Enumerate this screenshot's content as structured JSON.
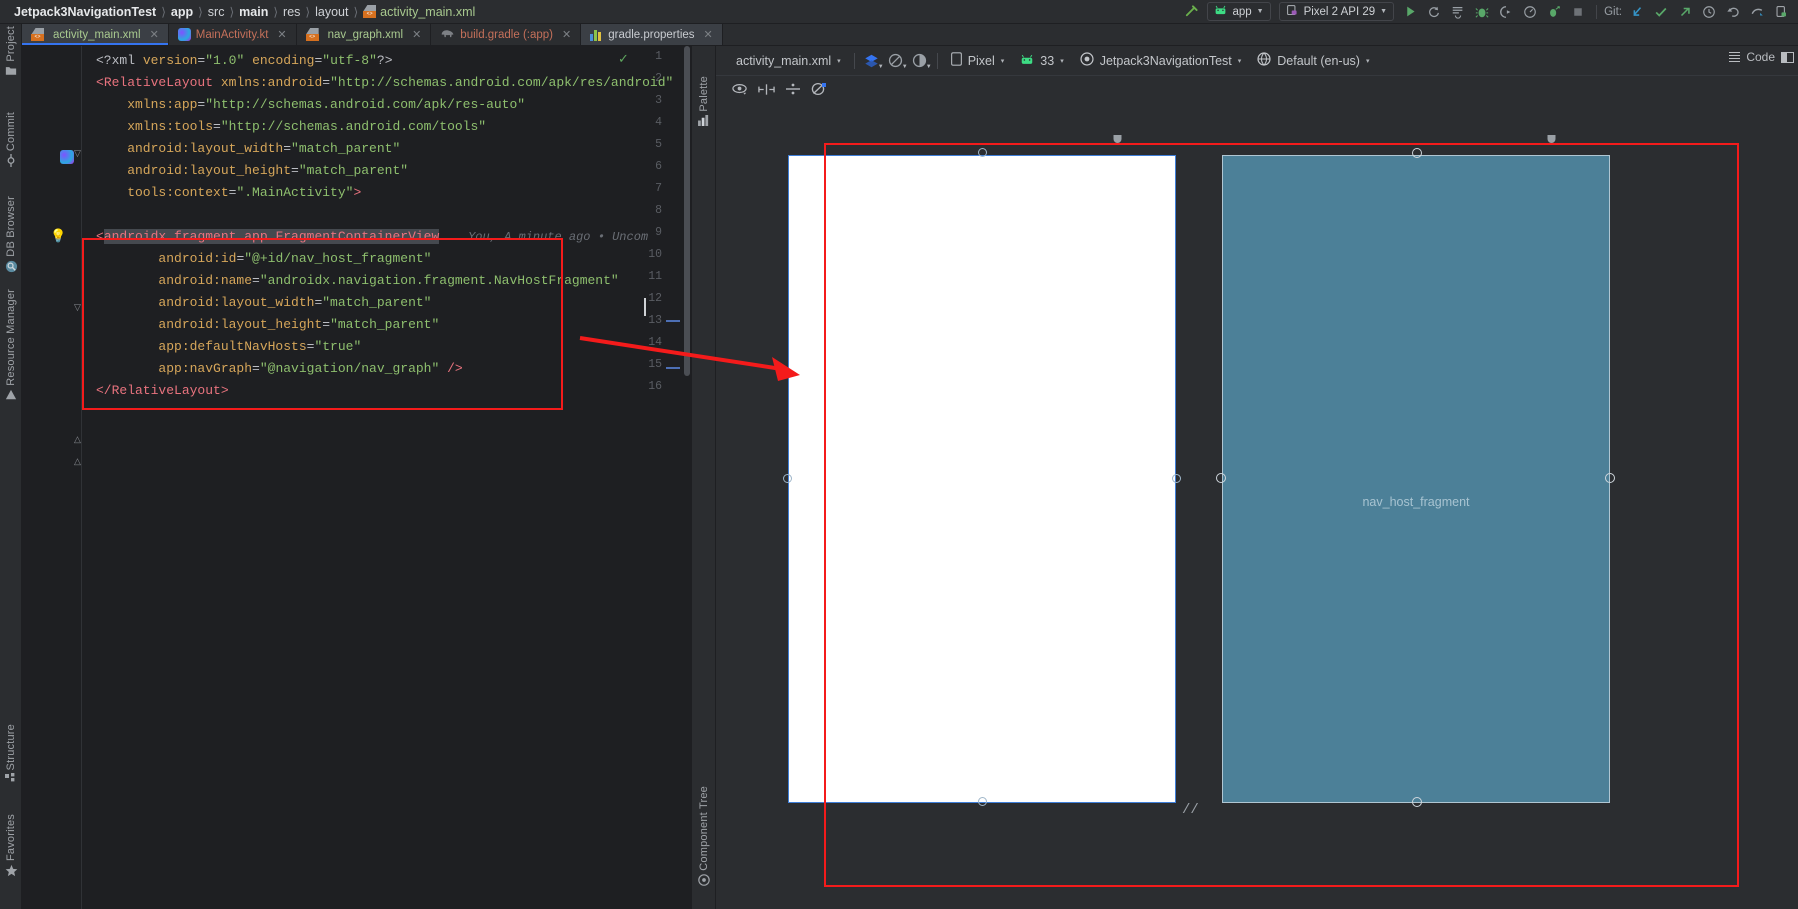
{
  "window": {
    "breadcrumb": [
      "Jetpack3NavigationTest",
      "app",
      "src",
      "main",
      "res",
      "layout",
      "activity_main.xml"
    ],
    "breadcrumb_file": "activity_main.xml"
  },
  "toolbar": {
    "run_config": "app",
    "device": "Pixel 2 API 29",
    "git_label": "Git:",
    "icons": [
      "hammer-icon",
      "run-icon",
      "rerun-icon",
      "run-with-coverage-icon",
      "debug-icon",
      "attach-debugger-icon",
      "profiler-icon",
      "profile-app-icon",
      "stop-icon",
      "git-update-icon",
      "git-commit-icon",
      "git-push-icon",
      "history-icon",
      "undo-icon",
      "search-everywhere-icon",
      "device-manager-icon"
    ]
  },
  "tabs": [
    {
      "label": "activity_main.xml",
      "icon": "xml-layout-icon",
      "active": true
    },
    {
      "label": "MainActivity.kt",
      "icon": "kotlin-icon",
      "active": false
    },
    {
      "label": "nav_graph.xml",
      "icon": "xml-layout-icon",
      "active": false
    },
    {
      "label": "build.gradle (:app)",
      "icon": "gradle-elephant-icon",
      "active": false
    },
    {
      "label": "gradle.properties",
      "icon": "gradle-properties-icon",
      "active": false
    }
  ],
  "view_switch": {
    "code_label": "Code",
    "split_icon": "split-view-icon",
    "code_icon": "code-view-icon"
  },
  "left_stripe": {
    "top": [
      {
        "label": "Project",
        "icon": "folder-icon"
      },
      {
        "label": "Commit",
        "icon": "commit-icon"
      },
      {
        "label": "DB Browser",
        "icon": "database-icon"
      },
      {
        "label": "Resource Manager",
        "icon": "resource-icon"
      }
    ],
    "bottom": [
      {
        "label": "Structure",
        "icon": "structure-icon"
      },
      {
        "label": "Favorites",
        "icon": "star-icon"
      }
    ]
  },
  "design_stripe": {
    "top_label": "Palette",
    "top_icon": "palette-icon",
    "bottom_label": "Component Tree",
    "bottom_icon": "component-tree-icon"
  },
  "design_toolbar": {
    "file": "activity_main.xml",
    "design_mode_icon": "layers-icon",
    "orientation_icon": "orientation-icon",
    "theme_icon": "night-mode-icon",
    "device": "Pixel",
    "api": "33",
    "theme": "Jetpack3NavigationTest",
    "locale": "Default (en-us)",
    "row2_icons": [
      "show-constraints-icon",
      "align-horizontal-icon",
      "align-vertical-icon",
      "clear-constraints-icon"
    ]
  },
  "canvas": {
    "device_label": "nav_host_fragment",
    "white_preview_name": "design-preview",
    "blueprint_preview_name": "blueprint-preview"
  },
  "code": {
    "lines": [
      {
        "n": 1,
        "segments": [
          {
            "t": "<?xml ",
            "c": "proc"
          },
          {
            "t": "version",
            "c": "attr"
          },
          {
            "t": "=",
            "c": "plain"
          },
          {
            "t": "\"1.0\"",
            "c": "str"
          },
          {
            "t": " ",
            "c": "plain"
          },
          {
            "t": "encoding",
            "c": "attr"
          },
          {
            "t": "=",
            "c": "plain"
          },
          {
            "t": "\"utf-8\"",
            "c": "str"
          },
          {
            "t": "?>",
            "c": "proc"
          }
        ]
      },
      {
        "n": 2,
        "segments": [
          {
            "t": "<",
            "c": "tag"
          },
          {
            "t": "RelativeLayout ",
            "c": "tag"
          },
          {
            "t": "xmlns:android",
            "c": "attr"
          },
          {
            "t": "=",
            "c": "plain"
          },
          {
            "t": "\"http://schemas.android.com/apk/res/android\"",
            "c": "str"
          }
        ]
      },
      {
        "n": 3,
        "segments": [
          {
            "t": "    xmlns:app",
            "c": "attr"
          },
          {
            "t": "=",
            "c": "plain"
          },
          {
            "t": "\"http://schemas.android.com/apk/res-auto\"",
            "c": "str"
          }
        ]
      },
      {
        "n": 4,
        "segments": [
          {
            "t": "    xmlns:tools",
            "c": "attr"
          },
          {
            "t": "=",
            "c": "plain"
          },
          {
            "t": "\"http://schemas.android.com/tools\"",
            "c": "str"
          }
        ]
      },
      {
        "n": 5,
        "segments": [
          {
            "t": "    android:layout_width",
            "c": "attr"
          },
          {
            "t": "=",
            "c": "plain"
          },
          {
            "t": "\"match_parent\"",
            "c": "str"
          }
        ]
      },
      {
        "n": 6,
        "segments": [
          {
            "t": "    android:layout_height",
            "c": "attr"
          },
          {
            "t": "=",
            "c": "plain"
          },
          {
            "t": "\"match_parent\"",
            "c": "str"
          }
        ]
      },
      {
        "n": 7,
        "segments": [
          {
            "t": "    tools:context",
            "c": "attr"
          },
          {
            "t": "=",
            "c": "plain"
          },
          {
            "t": "\".MainActivity\"",
            "c": "str"
          },
          {
            "t": ">",
            "c": "tag"
          }
        ]
      },
      {
        "n": 8,
        "segments": []
      },
      {
        "n": 9,
        "segments": [
          {
            "t": "<",
            "c": "tag"
          },
          {
            "t": "androidx",
            "c": "tag-sel"
          },
          {
            "t": ".fragment.app.FragmentContainerView",
            "c": "tag-sel2"
          }
        ],
        "annotation": "You, A minute ago • Uncom",
        "bulb": true
      },
      {
        "n": 10,
        "segments": [
          {
            "t": "        android:id",
            "c": "attr"
          },
          {
            "t": "=",
            "c": "plain"
          },
          {
            "t": "\"@+id/nav_host_fragment\"",
            "c": "str"
          }
        ]
      },
      {
        "n": 11,
        "segments": [
          {
            "t": "        android:name",
            "c": "attr"
          },
          {
            "t": "=",
            "c": "plain"
          },
          {
            "t": "\"androidx.navigation.fragment.NavHostFragment\"",
            "c": "str"
          }
        ]
      },
      {
        "n": 12,
        "segments": [
          {
            "t": "        android:layout_width",
            "c": "attr"
          },
          {
            "t": "=",
            "c": "plain"
          },
          {
            "t": "\"match_parent\"",
            "c": "str"
          }
        ]
      },
      {
        "n": 13,
        "segments": [
          {
            "t": "        android:layout_height",
            "c": "attr"
          },
          {
            "t": "=",
            "c": "plain"
          },
          {
            "t": "\"match_parent\"",
            "c": "str"
          }
        ]
      },
      {
        "n": 14,
        "segments": [
          {
            "t": "        app:defaultNavHosts",
            "c": "attr"
          },
          {
            "t": "=",
            "c": "plain"
          },
          {
            "t": "\"true\"",
            "c": "str"
          }
        ]
      },
      {
        "n": 15,
        "segments": [
          {
            "t": "        app:navGraph",
            "c": "attr"
          },
          {
            "t": "=",
            "c": "plain"
          },
          {
            "t": "\"@navigation/nav_graph\"",
            "c": "str"
          },
          {
            "t": " />",
            "c": "tag"
          }
        ]
      },
      {
        "n": 16,
        "segments": [
          {
            "t": "</RelativeLayout>",
            "c": "tag"
          }
        ]
      }
    ],
    "inspection_status": "ok-check"
  },
  "annotations": {
    "highlight_color": "#f41b1b",
    "arrow_name": "red-pointer-arrow"
  }
}
